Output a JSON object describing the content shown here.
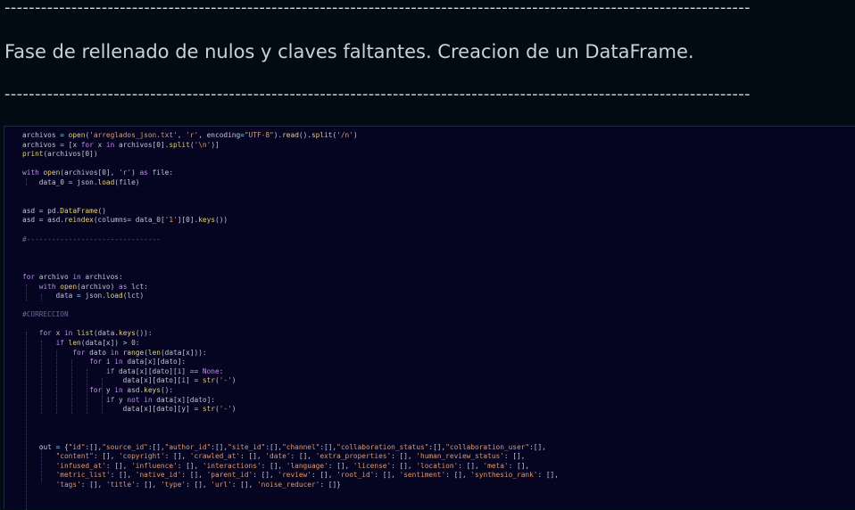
{
  "header": {
    "rule": "---------------------------------------------------------------------------------------------------------------------------",
    "title": "Fase de rellenado de nulos y claves faltantes. Creacion de un DataFrame."
  },
  "code": {
    "lines": [
      "archivos = open('arreglados_json.txt', 'r', encoding=\"UTF-8\").read().split('/n')",
      "archivos = [x for x in archivos[0].split('\\n')]",
      "print(archivos[0])",
      "",
      "with open(archivos[0], 'r') as file:",
      "    data_0 = json.load(file)",
      "",
      "",
      "asd = pd.DataFrame()",
      "asd = asd.reindex(columns= data_0['1'][0].keys())",
      "",
      "#--------------------------------",
      "",
      "",
      "",
      "for archivo in archivos:",
      "    with open(archivo) as lct:",
      "        data = json.load(lct)",
      "",
      "#CORRECCION",
      "",
      "    for x in list(data.keys()):",
      "        if len(data[x]) > 0:",
      "            for dato in range(len(data[x])):",
      "                for i in data[x][dato]:",
      "                    if data[x][dato][i] == None:",
      "                        data[x][dato][i] = str('-')",
      "                for y in asd.keys():",
      "                    if y not in data[x][dato]:",
      "                        data[x][dato][y] = str('-')",
      "",
      "",
      "",
      "    out = {\"id\":[],\"source_id\":[],\"author_id\":[],\"site_id\":[],\"channel\":[],\"collaboration_status\":[],\"collaboration_user\":[],",
      "        \"content\": [], 'copyright': [], 'crawled_at': [], 'date': [], 'extra_properties': [], 'human_review_status': [],",
      "        'infused_at': [], 'influence': [], 'interactions': [], 'language': [], 'license': [], 'location': [], 'meta': [],",
      "        'metric_list': [], 'native_id': [], 'parent_id': [], 'review': [], 'root_id': [], 'sentiment': [], 'synthesio_rank': [],",
      "        'tags': [], 'title': [], 'type': [], 'url': [], 'noise_reducer': []}"
    ]
  }
}
